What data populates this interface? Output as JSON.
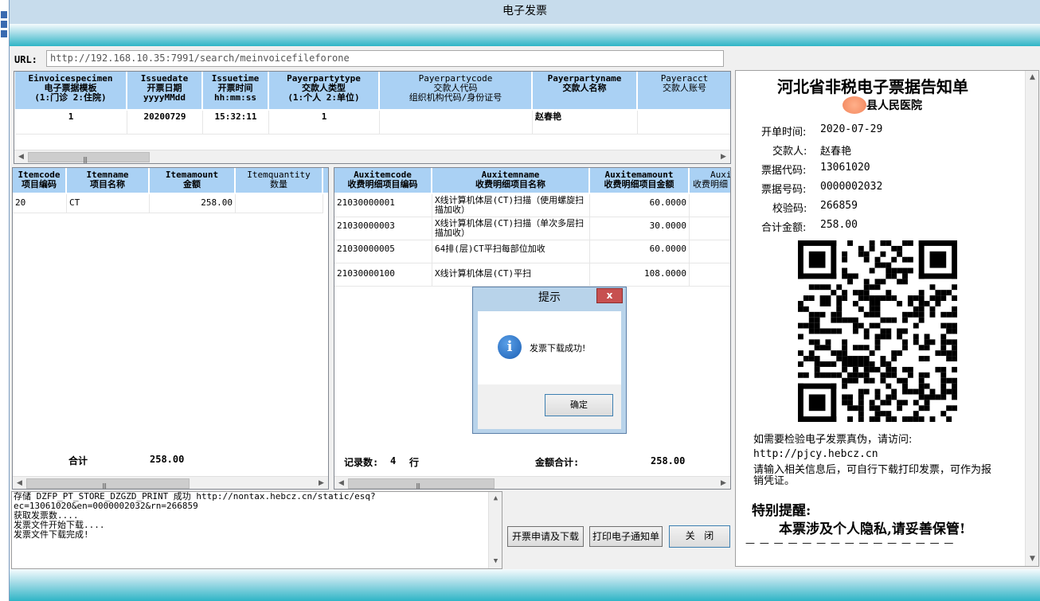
{
  "window": {
    "title": "电子发票"
  },
  "url": {
    "label": "URL:",
    "value": "http://192.168.10.35:7991/search/meinvoicefileforone"
  },
  "main_table": {
    "headers": [
      {
        "line1": "Einvoicespecimen",
        "line2": "电子票据模板",
        "line3": "(1:门诊 2:住院)"
      },
      {
        "line1": "Issuedate",
        "line2": "开票日期",
        "line3": "yyyyMMdd"
      },
      {
        "line1": "Issuetime",
        "line2": "开票时间",
        "line3": "hh:mm:ss"
      },
      {
        "line1": "Payerpartytype",
        "line2": "交款人类型",
        "line3": "(1:个人 2:单位)"
      },
      {
        "line1": "Payerpartycode",
        "line2": "交款人代码",
        "line3": "组织机构代码/身份证号"
      },
      {
        "line1": "Payerpartyname",
        "line2": "交款人名称",
        "line3": ""
      },
      {
        "line1": "Payeracct",
        "line2": "交款人账号",
        "line3": ""
      }
    ],
    "row": [
      "1",
      "20200729",
      "15:32:11",
      "1",
      "",
      "赵春艳",
      ""
    ]
  },
  "item_table": {
    "headers": [
      {
        "line1": "Itemcode",
        "line2": "项目编码"
      },
      {
        "line1": "Itemname",
        "line2": "项目名称"
      },
      {
        "line1": "Itemamount",
        "line2": "金额"
      },
      {
        "line1": "Itemquantity",
        "line2": "数量"
      }
    ],
    "rows": [
      {
        "code": "20",
        "name": "CT",
        "amount": "258.00",
        "qty": ""
      }
    ],
    "total_label": "合计",
    "total_value": "258.00"
  },
  "aux_table": {
    "headers": [
      {
        "line1": "Auxitemcode",
        "line2": "收费明细项目编码"
      },
      {
        "line1": "Auxitemname",
        "line2": "收费明细项目名称"
      },
      {
        "line1": "Auxitemamount",
        "line2": "收费明细项目金额"
      },
      {
        "line1": "Auxi",
        "line2": "收费明细"
      }
    ],
    "rows": [
      {
        "code": "21030000001",
        "name": "X线计算机体层(CT)扫描（使用螺旋扫描加收）",
        "amount": "60.0000"
      },
      {
        "code": "21030000003",
        "name": "X线计算机体层(CT)扫描（单次多层扫描加收）",
        "amount": "30.0000"
      },
      {
        "code": "21030000005",
        "name": "64排(层)CT平扫每部位加收",
        "amount": "60.0000"
      },
      {
        "code": "21030000100",
        "name": "X线计算机体层(CT)平扫",
        "amount": "108.0000"
      }
    ],
    "count_label": "记录数:",
    "count_value": "4",
    "count_unit": "行",
    "sum_label": "金额合计:",
    "sum_value": "258.00"
  },
  "log": {
    "lines": [
      "存储 DZFP_PT_STORE_DZGZD_PRINT 成功 http://nontax.hebcz.cn/static/esq?",
      "ec=13061020&en=0000002032&rn=266859",
      "获取发票数....",
      "发票文件开始下载....",
      "发票文件下载完成!"
    ]
  },
  "buttons": {
    "apply_download": "开票申请及下载",
    "print_notice": "打印电子通知单",
    "close": "关   闭"
  },
  "dialog": {
    "title": "提示",
    "close": "x",
    "message": "发票下载成功!",
    "ok": "确定"
  },
  "notice": {
    "title": "河北省非税电子票据告知单",
    "hospital": "县人民医院",
    "fields": [
      {
        "label": "开单时间:",
        "value": "2020-07-29"
      },
      {
        "label": "交款人:",
        "value": "赵春艳"
      },
      {
        "label": "票据代码:",
        "value": "13061020"
      },
      {
        "label": "票据号码:",
        "value": "0000002032"
      },
      {
        "label": "校验码:",
        "value": "266859"
      },
      {
        "label": "合计金额:",
        "value": "258.00"
      }
    ],
    "verify_text": "如需要检验电子发票真伪，请访问:",
    "verify_url": "http://pjcy.hebcz.cn",
    "instruction": "请输入相关信息后，可自行下载打印发票，可作为报销凭证。",
    "special_title": "特别提醒:",
    "special_text": "本票涉及个人隐私,请妥善保管!",
    "dashes": "— — — — — — — — — — — — — — —"
  },
  "colors": {
    "header_blue": "#aad1f4",
    "title_bar": "#c7dcec",
    "teal": "#2fb5c6",
    "close_red": "#c75050"
  }
}
